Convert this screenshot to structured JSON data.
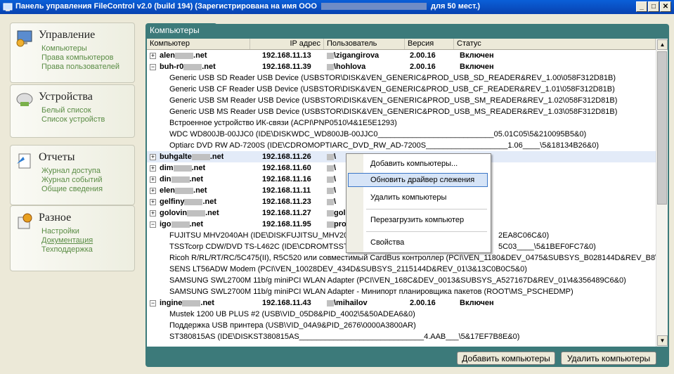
{
  "window": {
    "title_prefix": "Панель управления FileControl v2.0 (build 194) (Зарегистрирована на имя ООО",
    "title_suffix": "для 50 мест.)",
    "min_label": "_",
    "max_label": "□",
    "close_label": "✕"
  },
  "sidebar": {
    "groups": [
      {
        "title": "Управление",
        "links": [
          "Компьютеры",
          "Права компьютеров",
          "Права пользователей"
        ]
      },
      {
        "title": "Устройства",
        "links": [
          "Белый список",
          "Список устройств"
        ]
      },
      {
        "title": "Отчеты",
        "links": [
          "Журнал доступа",
          "Журнал событий",
          "Общие сведения"
        ]
      },
      {
        "title": "Разное",
        "links": [
          "Настройки",
          "Документация",
          "Техподдержка"
        ]
      }
    ]
  },
  "main": {
    "tab_label": "Компьютеры",
    "columns": [
      "Компьютер",
      "IP адрес",
      "Пользователь",
      "Версия",
      "Статус"
    ],
    "computers": [
      {
        "name_a": "alen",
        "name_b": ".net",
        "ip": "192.168.11.13",
        "user": "\\zigangirova",
        "ver": "2.00.16",
        "status": "Включен",
        "exp": "+"
      },
      {
        "name_a": "buh-r0",
        "name_b": ".net",
        "ip": "192.168.11.39",
        "user": "\\hohlova",
        "ver": "2.00.16",
        "status": "Включен",
        "exp": "−"
      },
      {
        "name_a": "buhgalte",
        "name_b": ".net",
        "ip": "192.168.11.26",
        "user": "\\",
        "ver": "",
        "status": "ен",
        "exp": "+"
      },
      {
        "name_a": "dim",
        "name_b": ".net",
        "ip": "192.168.11.60",
        "user": "\\",
        "ver": "",
        "status": "ен",
        "exp": "+"
      },
      {
        "name_a": "din",
        "name_b": ".net",
        "ip": "192.168.11.16",
        "user": "\\",
        "ver": "",
        "status": "ен",
        "exp": "+"
      },
      {
        "name_a": "elen",
        "name_b": ".net",
        "ip": "192.168.11.11",
        "user": "\\",
        "ver": "",
        "status": "ен",
        "exp": "+"
      },
      {
        "name_a": "gelfiny",
        "name_b": ".net",
        "ip": "192.168.11.23",
        "user": "\\",
        "ver": "",
        "status": "ен",
        "exp": "+"
      },
      {
        "name_a": "golovin",
        "name_b": ".net",
        "ip": "192.168.11.27",
        "user": "golo",
        "ver": "",
        "status": "зи",
        "exp": "+"
      },
      {
        "name_a": "igo",
        "name_b": ".net",
        "ip": "192.168.11.95",
        "user": "prot",
        "ver": "",
        "status": "ен",
        "exp": "−"
      },
      {
        "name_a": "ingine",
        "name_b": ".net",
        "ip": "192.168.11.43",
        "user": "\\mihailov",
        "ver": "2.00.16",
        "status": "Включен",
        "exp": "−"
      }
    ],
    "devices_buh": [
      "Generic USB SD Reader USB Device (USBSTOR\\DISK&VEN_GENERIC&PROD_USB_SD_READER&REV_1.00\\058F312D81B)",
      "Generic USB CF Reader USB Device (USBSTOR\\DISK&VEN_GENERIC&PROD_USB_CF_READER&REV_1.01\\058F312D81B)",
      "Generic USB SM Reader USB Device (USBSTOR\\DISK&VEN_GENERIC&PROD_USB_SM_READER&REV_1.02\\058F312D81B)",
      "Generic USB MS Reader USB Device (USBSTOR\\DISK&VEN_GENERIC&PROD_USB_MS_READER&REV_1.03\\058F312D81B)",
      "Встроенное устройство ИК-связи (ACPI\\PNP0510\\4&1E5E1293)",
      "WDC WD800JB-00JJC0 (IDE\\DISKWDC_WD800JB-00JJC0___________________________05.01C05\\5&210095B5&0)",
      "Optiarc DVD RW AD-7200S (IDE\\CDROMOPTIARC_DVD_RW_AD-7200S___________________1.06____\\5&18134B26&0)"
    ],
    "devices_igo": [
      "FUJITSU MHV2040AH (IDE\\DISKFUJITSU_MHV2040AH",
      "TSSTcorp CDW/DVD TS-L462C (IDE\\CDROMTSSTCO",
      "Ricoh R/RL/RT/RC/5C475(II), R5C520 или совместимый CardBus контроллер (PCI\\VEN_1180&DEV_0475&SUBSYS_B028144D&REV_B8\\4&356",
      "SENS LT56ADW Modem (PCI\\VEN_10028DEV_434D&SUBSYS_2115144D&REV_01\\3&13C0B0C5&0)",
      "SAMSUNG SWL2700M 11b/g miniPCI WLAN Adapter (PCI\\VEN_168C&DEV_0013&SUBSYS_A527167D&REV_01\\4&356489C6&0)",
      "SAMSUNG SWL2700M 11b/g miniPCI WLAN Adapter - Минипорт планировщика пакетов (ROOT\\MS_PSCHEDMP)"
    ],
    "devices_igo_tail": [
      "2EA8C06C&0)",
      "5C03____\\5&1BEF0FC7&0)"
    ],
    "devices_ingine": [
      "Mustek 1200 UB PLUS #2 (USB\\VID_05D8&PID_4002\\5&50ADEA6&0)",
      "Поддержка USB принтера (USB\\VID_04A9&PID_2676\\0000A3800AR)",
      "ST380815AS (IDE\\DISKST380815AS_____________________________4.AAB___\\5&17EF7B8E&0)"
    ],
    "add_button": "Добавить компьютеры",
    "delete_button": "Удалить компьютеры"
  },
  "context_menu": {
    "items": [
      "Добавить компьютеры...",
      "Обновить драйвер слежения",
      "Удалить компьютеры",
      "Перезагрузить компьютер",
      "Свойства"
    ]
  }
}
